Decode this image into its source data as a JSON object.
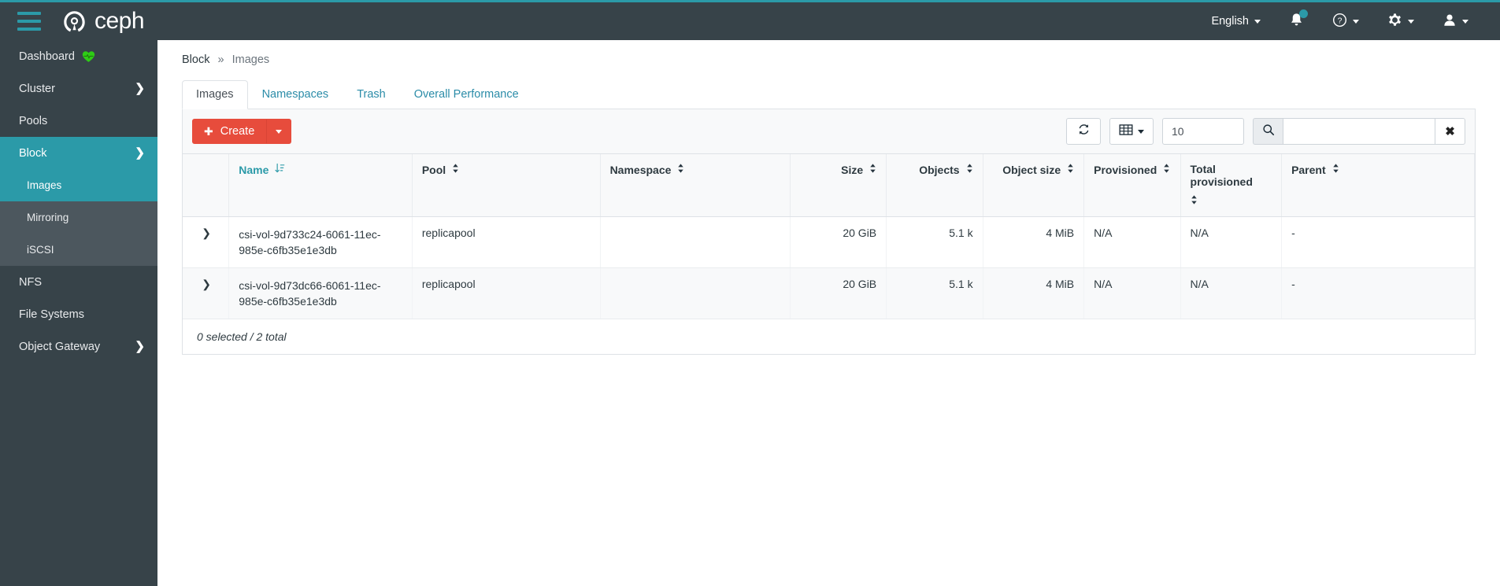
{
  "navbar": {
    "brand": "ceph",
    "menu_icon": "hamburger-icon",
    "language": "English",
    "notifications_icon": "bell-icon",
    "help_icon": "help-circle-icon",
    "settings_icon": "gear-icon",
    "user_icon": "user-icon",
    "accent_color": "#2b9aa8",
    "background_color": "#374349"
  },
  "sidebar": {
    "items": [
      {
        "label": "Dashboard",
        "state": "normal",
        "icon": "heart-pulse-icon",
        "level": "top"
      },
      {
        "label": "Cluster",
        "state": "normal",
        "chevron": "chevron-right",
        "level": "top"
      },
      {
        "label": "Pools",
        "state": "normal",
        "level": "top"
      },
      {
        "label": "Block",
        "state": "active",
        "chevron": "chevron-down",
        "level": "top"
      },
      {
        "label": "Images",
        "state": "active",
        "level": "sub"
      },
      {
        "label": "Mirroring",
        "state": "normal",
        "level": "sub"
      },
      {
        "label": "iSCSI",
        "state": "normal",
        "level": "sub"
      },
      {
        "label": "NFS",
        "state": "normal",
        "level": "top"
      },
      {
        "label": "File Systems",
        "state": "normal",
        "level": "top"
      },
      {
        "label": "Object Gateway",
        "state": "normal",
        "chevron": "chevron-right",
        "level": "top"
      }
    ]
  },
  "breadcrumb": {
    "root": "Block",
    "separator": "»",
    "current": "Images"
  },
  "tabs": [
    {
      "label": "Images",
      "active": true
    },
    {
      "label": "Namespaces",
      "active": false
    },
    {
      "label": "Trash",
      "active": false
    },
    {
      "label": "Overall Performance",
      "active": false
    }
  ],
  "toolbar": {
    "create_label": "Create",
    "create_color": "#e74c3c",
    "create_plus_icon": "plus-icon",
    "create_caret_icon": "caret-down-icon",
    "refresh_icon": "refresh-icon",
    "columns_icon": "table-columns-icon",
    "page_size_value": "10",
    "search_icon": "search-icon",
    "search_value": "",
    "search_placeholder": "",
    "clear_icon": "close-x-icon"
  },
  "table": {
    "columns": [
      {
        "label": "Name",
        "sorted": true,
        "sort_icon": "sort-asc-icon",
        "align": "left"
      },
      {
        "label": "Pool",
        "sorted": false,
        "sort_icon": "sort-icon",
        "align": "left"
      },
      {
        "label": "Namespace",
        "sorted": false,
        "sort_icon": "sort-icon",
        "align": "left"
      },
      {
        "label": "Size",
        "sorted": false,
        "sort_icon": "sort-icon",
        "align": "right"
      },
      {
        "label": "Objects",
        "sorted": false,
        "sort_icon": "sort-icon",
        "align": "right"
      },
      {
        "label": "Object size",
        "sorted": false,
        "sort_icon": "sort-icon",
        "align": "right"
      },
      {
        "label": "Provisioned",
        "sorted": false,
        "sort_icon": "sort-icon",
        "align": "left"
      },
      {
        "label": "Total provisioned",
        "sorted": false,
        "sort_icon": "sort-icon",
        "align": "left"
      },
      {
        "label": "Parent",
        "sorted": false,
        "sort_icon": "sort-icon",
        "align": "left"
      }
    ],
    "rows": [
      {
        "expander": "chevron-right-icon",
        "name": "csi-vol-9d733c24-6061-11ec-985e-c6fb35e1e3db",
        "pool": "replicapool",
        "namespace": "",
        "size": "20 GiB",
        "objects": "5.1 k",
        "object_size": "4 MiB",
        "provisioned": "N/A",
        "total_provisioned": "N/A",
        "parent": "-"
      },
      {
        "expander": "chevron-right-icon",
        "name": "csi-vol-9d73dc66-6061-11ec-985e-c6fb35e1e3db",
        "pool": "replicapool",
        "namespace": "",
        "size": "20 GiB",
        "objects": "5.1 k",
        "object_size": "4 MiB",
        "provisioned": "N/A",
        "total_provisioned": "N/A",
        "parent": "-"
      }
    ],
    "footer": "0 selected / 2 total"
  }
}
